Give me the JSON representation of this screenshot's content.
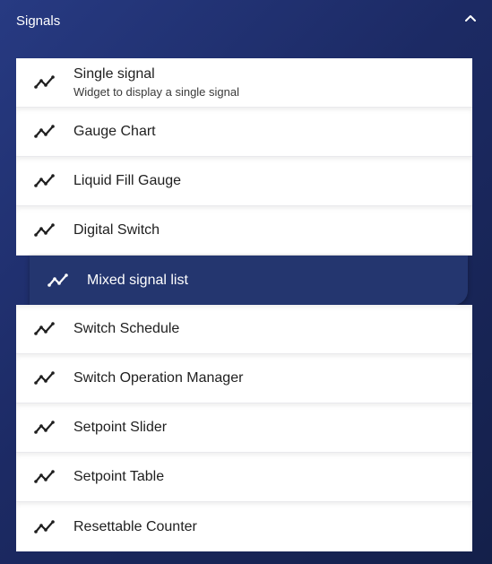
{
  "panel": {
    "title": "Signals",
    "collapse_icon": "chevron-up-icon"
  },
  "items": [
    {
      "label": "Single signal",
      "sublabel": "Widget to display a single signal",
      "icon": "trend-line-icon"
    },
    {
      "label": "Gauge Chart",
      "icon": "trend-line-icon"
    },
    {
      "label": "Liquid Fill Gauge",
      "icon": "trend-line-icon"
    },
    {
      "label": "Digital Switch",
      "icon": "trend-line-icon"
    },
    {
      "label": "Mixed signal list",
      "icon": "trend-line-icon",
      "selected": true
    },
    {
      "label": "Switch Schedule",
      "icon": "trend-line-icon"
    },
    {
      "label": "Switch Operation Manager",
      "icon": "trend-line-icon"
    },
    {
      "label": "Setpoint Slider",
      "icon": "trend-line-icon"
    },
    {
      "label": "Setpoint Table",
      "icon": "trend-line-icon"
    },
    {
      "label": "Resettable Counter",
      "icon": "trend-line-icon"
    }
  ],
  "colors": {
    "background": "#1c2a64",
    "selected_background": "#24366f",
    "item_background": "#ffffff",
    "text_dark": "#1f1f1f",
    "text_light": "#ffffff"
  }
}
